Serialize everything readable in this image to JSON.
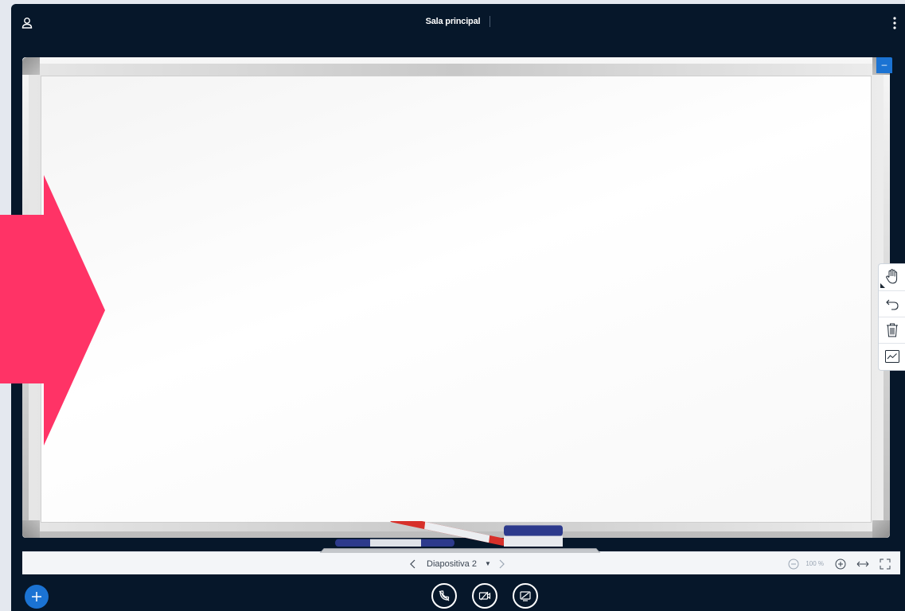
{
  "header": {
    "title": "Sala principal",
    "user_icon": "user-icon",
    "options_icon": "more-vertical-icon"
  },
  "whiteboard": {
    "minimize_label": "–",
    "accent_color": "#1b73d3"
  },
  "tools": [
    {
      "name": "hand-tool",
      "icon": "hand-icon"
    },
    {
      "name": "undo-tool",
      "icon": "undo-icon"
    },
    {
      "name": "clear-tool",
      "icon": "trash-icon"
    },
    {
      "name": "multiuser-tool",
      "icon": "chart-line-icon"
    }
  ],
  "presentation": {
    "slide_label": "Diapositiva 2",
    "caret": "▼",
    "zoom_value": "100 %"
  },
  "actions": {
    "add_icon": "plus-icon",
    "audio_icon": "audio-off-icon",
    "video_icon": "video-off-icon",
    "screen_icon": "screenshare-off-icon"
  },
  "colors": {
    "background": "#06172a",
    "accent": "#1b73d3",
    "overlay_arrow": "#ff3366"
  }
}
